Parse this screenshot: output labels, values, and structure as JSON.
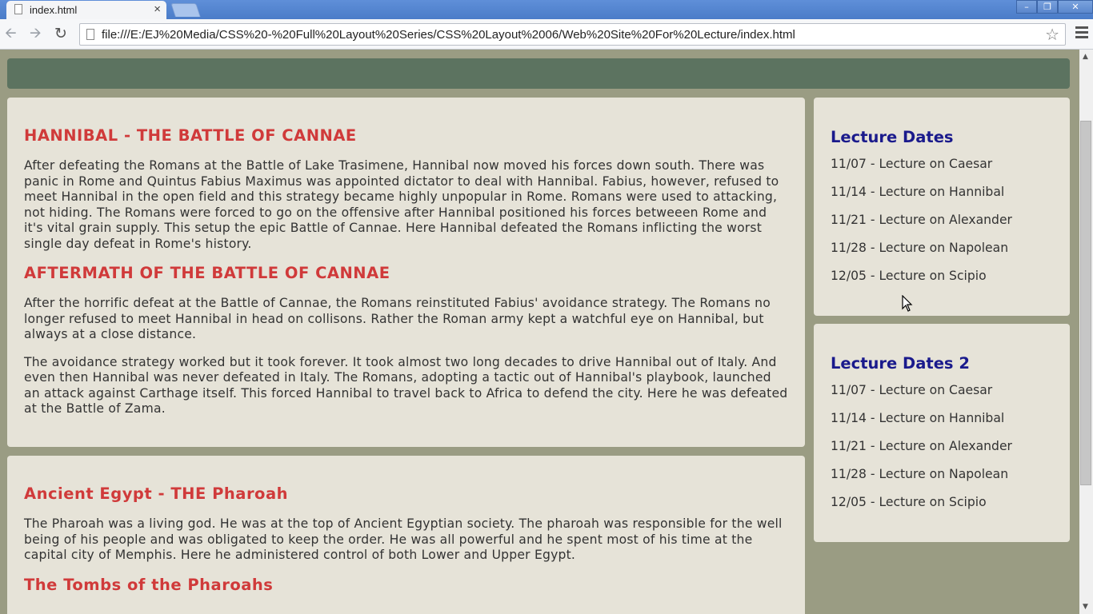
{
  "browser": {
    "tab_title": "index.html",
    "tab_close": "×",
    "url": "file:///E:/EJ%20Media/CSS%20-%20Full%20Layout%20Series/CSS%20Layout%2006/Web%20Site%20For%20Lecture/index.html",
    "icons": [
      "back-arrow-icon",
      "forward-arrow-icon",
      "reload-icon",
      "bookmark-star-icon",
      "menu-icon",
      "page-icon"
    ]
  },
  "articles": [
    {
      "heading": "HANNIBAL - THE BATTLE OF CANNAE",
      "paragraphs": [
        "After defeating the Romans at the Battle of Lake Trasimene, Hannibal now moved his forces down south. There was panic in Rome and Quintus Fabius Maximus was appointed dictator to deal with Hannibal. Fabius, however, refused to meet Hannibal in the open field and this strategy became highly unpopular in Rome. Romans were used to attacking, not hiding. The Romans were forced to go on the offensive after Hannibal positioned his forces betweeen Rome and it's vital grain supply. This setup the epic Battle of Cannae. Here Hannibal defeated the Romans inflicting the worst single day defeat in Rome's history."
      ]
    },
    {
      "heading": "AFTERMATH OF THE BATTLE OF CANNAE",
      "paragraphs": [
        "After the horrific defeat at the Battle of Cannae, the Romans reinstituted Fabius' avoidance strategy. The Romans no longer refused to meet Hannibal in head on collisons. Rather the Roman army kept a watchful eye on Hannibal, but always at a close distance.",
        "The avoidance strategy worked but it took forever. It took almost two long decades to drive Hannibal out of Italy. And even then Hannibal was never defeated in Italy. The Romans, adopting a tactic out of Hannibal's playbook, launched an attack against Carthage itself. This forced Hannibal to travel back to Africa to defend the city. Here he was defeated at the Battle of Zama."
      ]
    },
    {
      "heading": "Ancient Egypt - THE Pharoah",
      "paragraphs": [
        "The Pharoah was a living god. He was at the top of Ancient Egyptian society. The pharoah was responsible for the well being of his people and was obligated to keep the order. He was all powerful and he spent most of his time at the capital city of Memphis. Here he administered control of both Lower and Upper Egypt."
      ]
    },
    {
      "heading": "The Tombs of the Pharoahs",
      "paragraphs": []
    }
  ],
  "sidebars": [
    {
      "heading": "Lecture Dates",
      "items": [
        "11/07 - Lecture on Caesar",
        "11/14 - Lecture on Hannibal",
        "11/21 - Lecture on Alexander",
        "11/28 - Lecture on Napolean",
        "12/05 - Lecture on Scipio"
      ]
    },
    {
      "heading": "Lecture Dates 2",
      "items": [
        "11/07 - Lecture on Caesar",
        "11/14 - Lecture on Hannibal",
        "11/21 - Lecture on Alexander",
        "11/28 - Lecture on Napolean",
        "12/05 - Lecture on Scipio"
      ]
    }
  ],
  "colors": {
    "header_bar": "#5c7360",
    "page_background": "#9a9c83",
    "panel_background": "#e6e3d8",
    "article_heading": "#d03a3a",
    "sidebar_heading": "#1a1a8c"
  }
}
